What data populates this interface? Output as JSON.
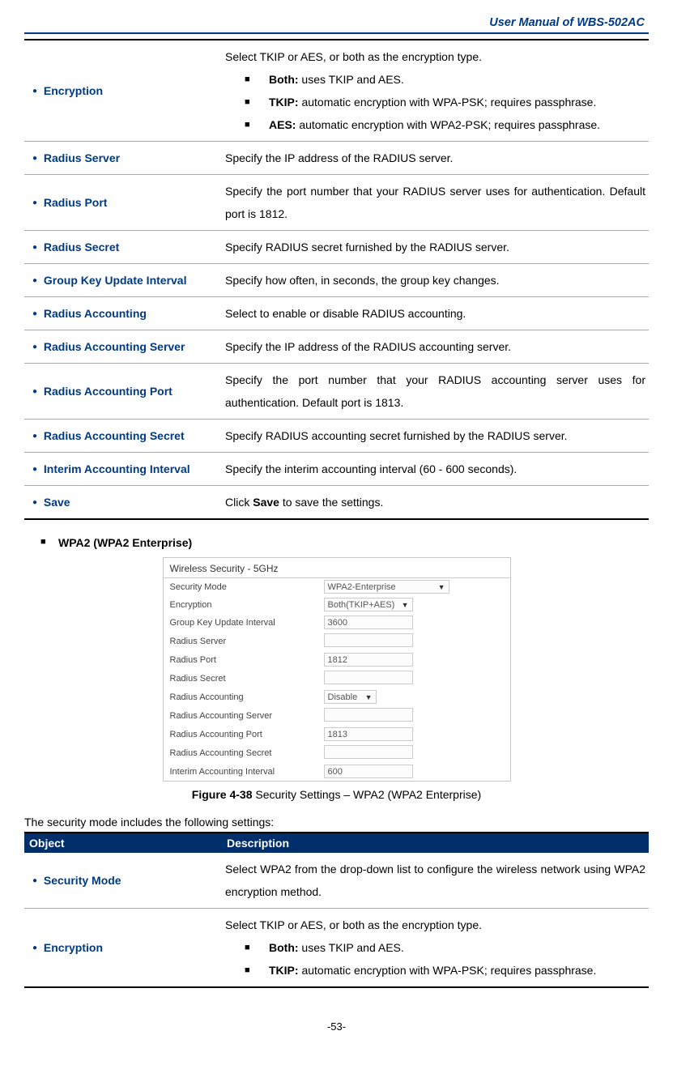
{
  "header": {
    "title": "User Manual of WBS-502AC"
  },
  "table1": {
    "rows": [
      {
        "object": "Encryption",
        "desc_intro": "Select TKIP or AES, or both as the encryption type.",
        "items": [
          {
            "bold": "Both:",
            "text": " uses TKIP and AES."
          },
          {
            "bold": "TKIP:",
            "text": " automatic encryption with WPA-PSK; requires passphrase."
          },
          {
            "bold": "AES:",
            "text": " automatic encryption with WPA2-PSK; requires passphrase."
          }
        ]
      },
      {
        "object": "Radius Server",
        "desc": "Specify the IP address of the RADIUS server."
      },
      {
        "object": "Radius Port",
        "desc": "Specify the port number that your RADIUS server uses for authentication. Default port is 1812."
      },
      {
        "object": "Radius Secret",
        "desc": "Specify RADIUS secret furnished by the RADIUS server."
      },
      {
        "object": "Group Key Update Interval",
        "desc": "Specify how often, in seconds, the group key changes."
      },
      {
        "object": "Radius Accounting",
        "desc": "Select to enable or disable RADIUS accounting."
      },
      {
        "object": "Radius Accounting Server",
        "desc": "Specify the IP address of the RADIUS accounting server."
      },
      {
        "object": "Radius Accounting Port",
        "desc": "Specify the port number that your RADIUS accounting server uses for authentication. Default port is 1813."
      },
      {
        "object": "Radius Accounting Secret",
        "desc": "Specify RADIUS accounting secret furnished by the RADIUS server."
      },
      {
        "object": "Interim Accounting Interval",
        "desc": "Specify the interim accounting interval (60 - 600 seconds)."
      },
      {
        "object": "Save",
        "desc_prefix": "Click ",
        "desc_bold": "Save",
        "desc_suffix": " to save the settings."
      }
    ]
  },
  "section_heading": "WPA2 (WPA2 Enterprise)",
  "panel": {
    "title": "Wireless Security - 5GHz",
    "rows": [
      {
        "label": "Security Mode",
        "type": "select",
        "size": "wide",
        "value": "WPA2-Enterprise"
      },
      {
        "label": "Encryption",
        "type": "select",
        "size": "med",
        "value": "Both(TKIP+AES)"
      },
      {
        "label": "Group Key Update Interval",
        "type": "input",
        "value": "3600"
      },
      {
        "label": "Radius Server",
        "type": "input",
        "value": ""
      },
      {
        "label": "Radius Port",
        "type": "input",
        "value": "1812"
      },
      {
        "label": "Radius Secret",
        "type": "input",
        "value": ""
      },
      {
        "label": "Radius Accounting",
        "type": "select",
        "size": "small",
        "value": "Disable"
      },
      {
        "label": "Radius Accounting Server",
        "type": "input",
        "value": ""
      },
      {
        "label": "Radius Accounting Port",
        "type": "input",
        "value": "1813"
      },
      {
        "label": "Radius Accounting Secret",
        "type": "input",
        "value": ""
      },
      {
        "label": "Interim Accounting Interval",
        "type": "input",
        "value": "600"
      }
    ]
  },
  "figure_caption_bold": "Figure 4-38",
  "figure_caption_rest": " Security Settings – WPA2 (WPA2 Enterprise)",
  "intro_line": "The security mode includes the following settings:",
  "table2": {
    "headers": {
      "object": "Object",
      "description": "Description"
    },
    "rows": [
      {
        "object": "Security Mode",
        "desc": "Select WPA2 from the drop-down list to configure the wireless network using WPA2 encryption method."
      },
      {
        "object": "Encryption",
        "desc_intro": "Select TKIP or AES, or both as the encryption type.",
        "items": [
          {
            "bold": "Both:",
            "text": " uses TKIP and AES."
          },
          {
            "bold": "TKIP:",
            "text": " automatic encryption with WPA-PSK; requires passphrase."
          }
        ]
      }
    ]
  },
  "page_number": "-53-"
}
